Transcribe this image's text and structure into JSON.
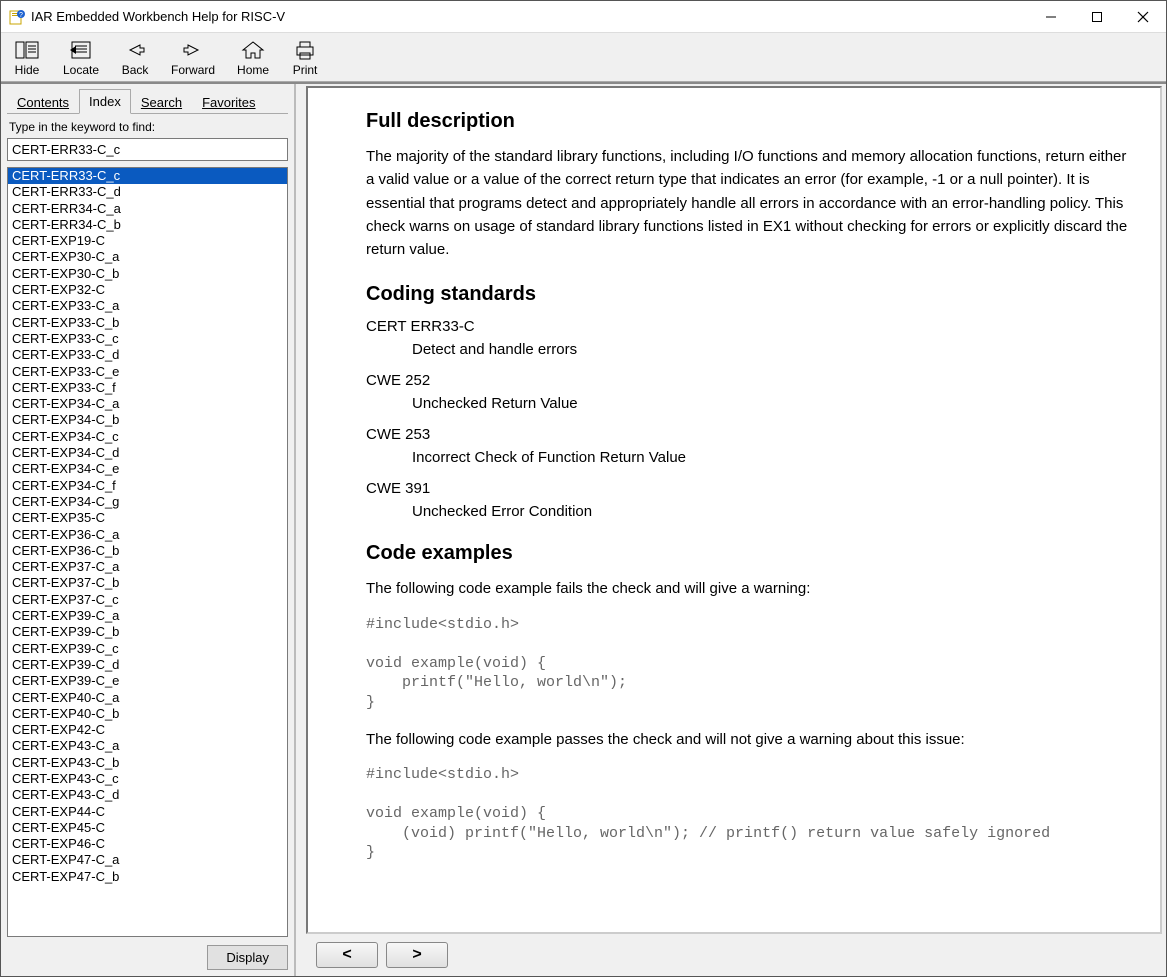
{
  "window": {
    "title": "IAR Embedded Workbench Help for RISC-V"
  },
  "toolbar": {
    "hide": "Hide",
    "locate": "Locate",
    "back": "Back",
    "forward": "Forward",
    "home": "Home",
    "print": "Print"
  },
  "tabs": {
    "contents": "Contents",
    "index": "Index",
    "search": "Search",
    "favorites": "Favorites"
  },
  "left": {
    "instruction": "Type in the keyword to find:",
    "search_value": "CERT-ERR33-C_c",
    "display": "Display",
    "items": [
      "CERT-ERR33-C_c",
      "CERT-ERR33-C_d",
      "CERT-ERR34-C_a",
      "CERT-ERR34-C_b",
      "CERT-EXP19-C",
      "CERT-EXP30-C_a",
      "CERT-EXP30-C_b",
      "CERT-EXP32-C",
      "CERT-EXP33-C_a",
      "CERT-EXP33-C_b",
      "CERT-EXP33-C_c",
      "CERT-EXP33-C_d",
      "CERT-EXP33-C_e",
      "CERT-EXP33-C_f",
      "CERT-EXP34-C_a",
      "CERT-EXP34-C_b",
      "CERT-EXP34-C_c",
      "CERT-EXP34-C_d",
      "CERT-EXP34-C_e",
      "CERT-EXP34-C_f",
      "CERT-EXP34-C_g",
      "CERT-EXP35-C",
      "CERT-EXP36-C_a",
      "CERT-EXP36-C_b",
      "CERT-EXP37-C_a",
      "CERT-EXP37-C_b",
      "CERT-EXP37-C_c",
      "CERT-EXP39-C_a",
      "CERT-EXP39-C_b",
      "CERT-EXP39-C_c",
      "CERT-EXP39-C_d",
      "CERT-EXP39-C_e",
      "CERT-EXP40-C_a",
      "CERT-EXP40-C_b",
      "CERT-EXP42-C",
      "CERT-EXP43-C_a",
      "CERT-EXP43-C_b",
      "CERT-EXP43-C_c",
      "CERT-EXP43-C_d",
      "CERT-EXP44-C",
      "CERT-EXP45-C",
      "CERT-EXP46-C",
      "CERT-EXP47-C_a",
      "CERT-EXP47-C_b"
    ],
    "selected_index": 0
  },
  "content": {
    "h_full": "Full description",
    "p_full": "The majority of the standard library functions, including I/O functions and memory allocation functions, return either a valid value or a value of the correct return type that indicates an error (for example, -1 or a null pointer). It is essential that programs detect and appropriately handle all errors in accordance with an error-handling policy. This check warns on usage of standard library functions listed in EX1 without checking for errors or explicitly discard the return value.",
    "h_coding": "Coding standards",
    "std1_label": "CERT ERR33-C",
    "std1_desc": "Detect and handle errors",
    "std2_label": "CWE 252",
    "std2_desc": "Unchecked Return Value",
    "std3_label": "CWE 253",
    "std3_desc": "Incorrect Check of Function Return Value",
    "std4_label": "CWE 391",
    "std4_desc": "Unchecked Error Condition",
    "h_examples": "Code examples",
    "p_fail": "The following code example fails the check and will give a warning:",
    "code_fail": "#include<stdio.h>\n\nvoid example(void) {\n    printf(\"Hello, world\\n\");\n}",
    "p_pass": "The following code example passes the check and will not give a warning about this issue:",
    "code_pass": "#include<stdio.h>\n\nvoid example(void) {\n    (void) printf(\"Hello, world\\n\"); // printf() return value safely ignored\n}"
  },
  "nav": {
    "prev": "<",
    "next": ">"
  }
}
